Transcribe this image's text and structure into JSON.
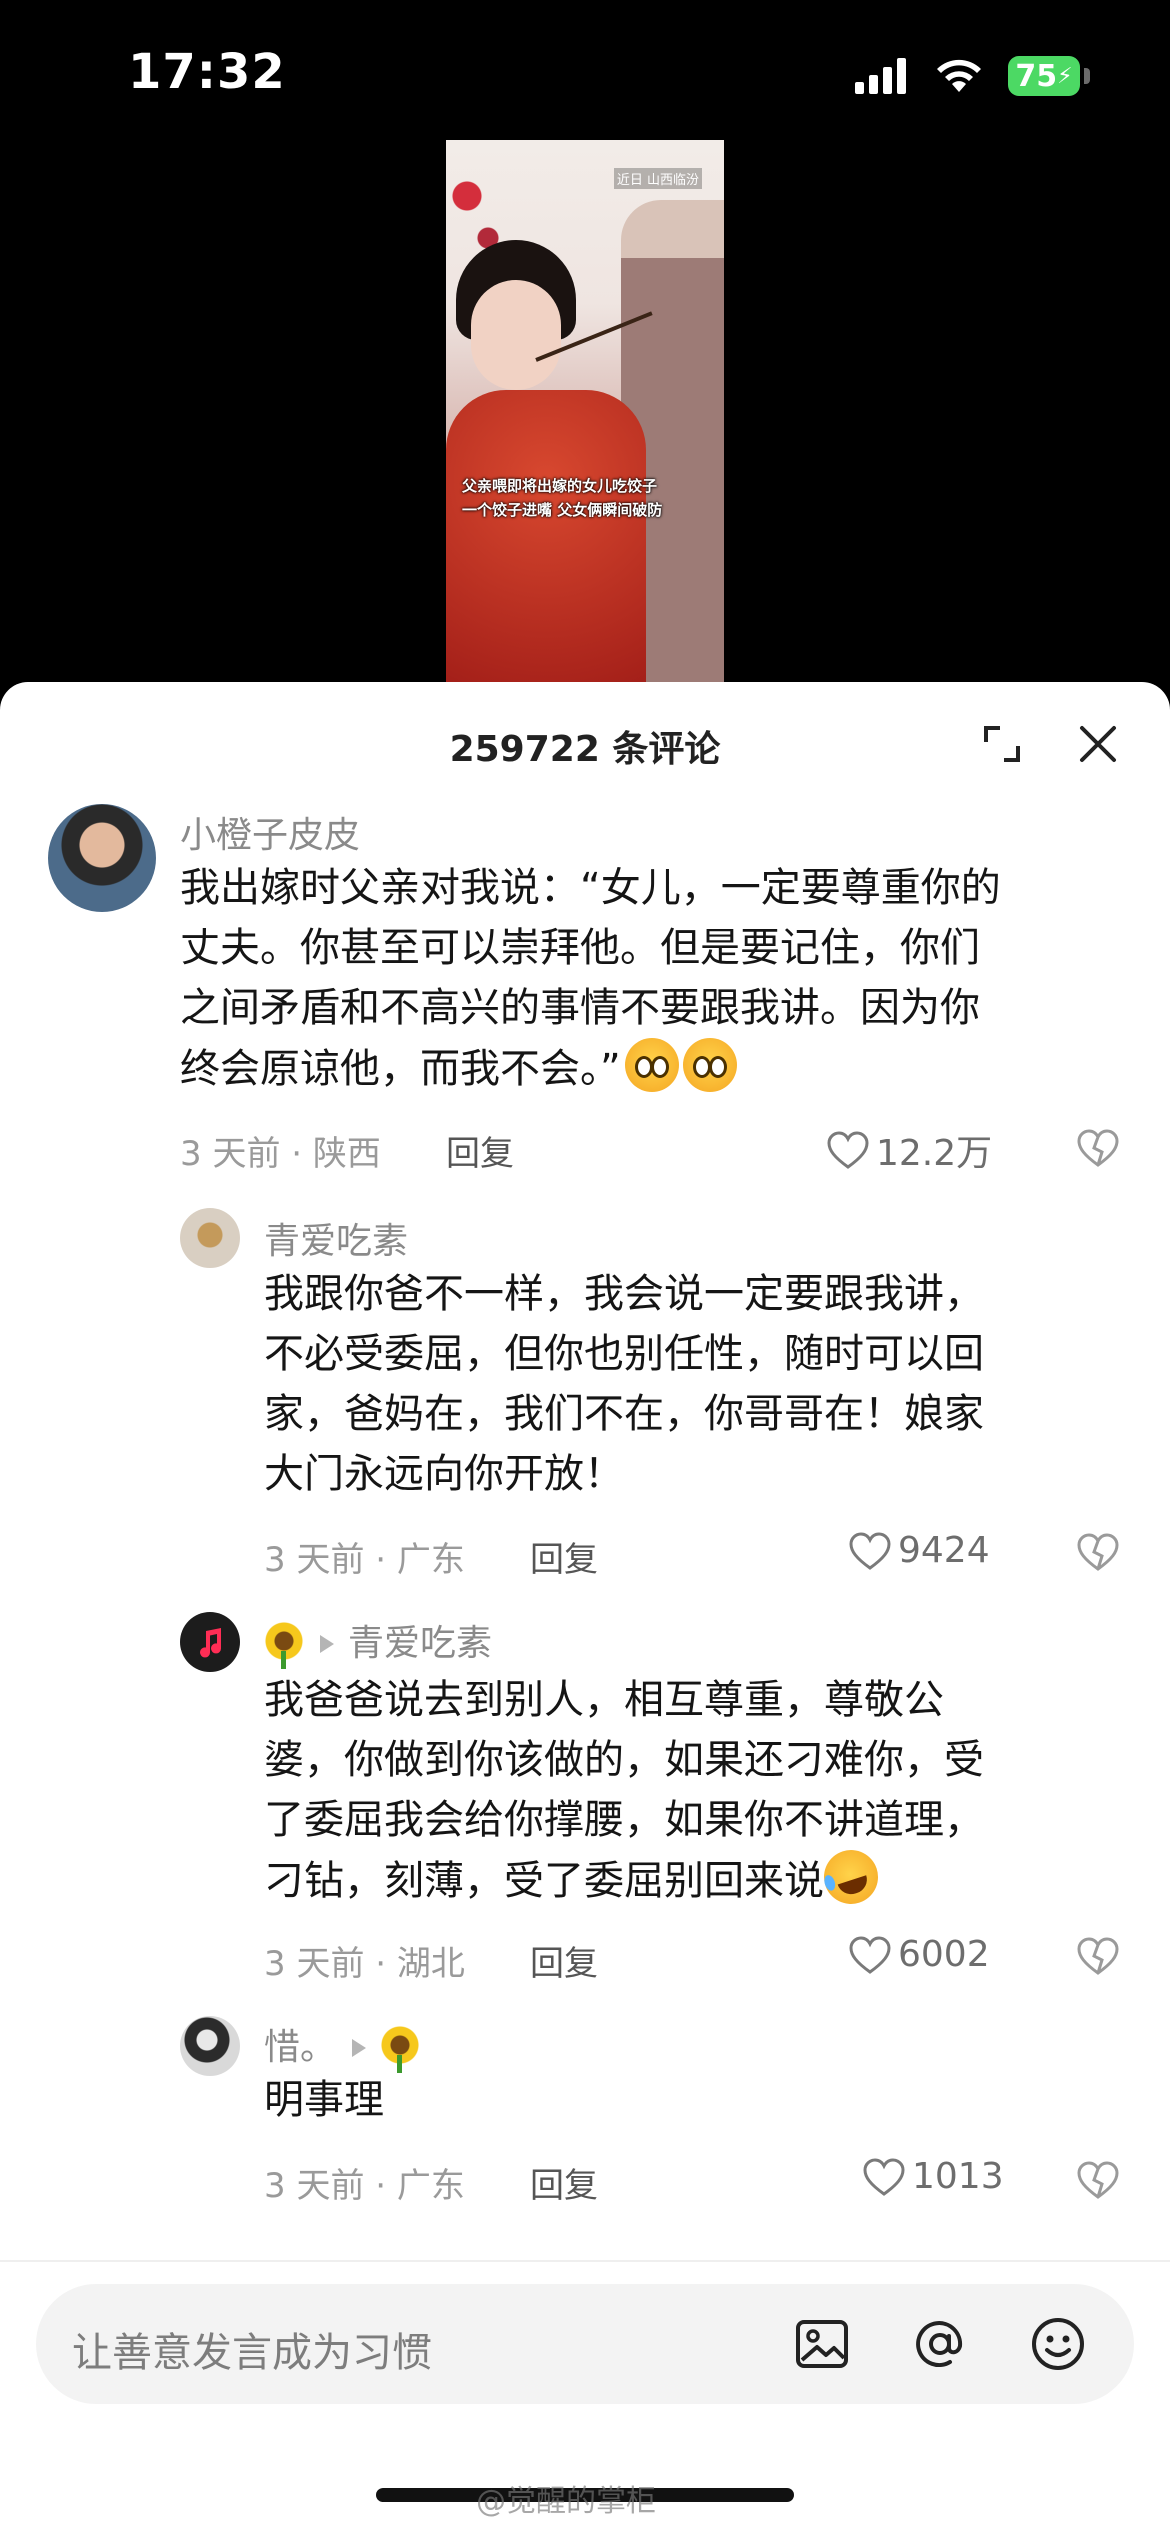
{
  "status_bar": {
    "time": "17:32",
    "battery": "75"
  },
  "video": {
    "location_tag": "近日 山西临汾",
    "caption_line1": "父亲喂即将出嫁的女儿吃饺子",
    "caption_line2": "一个饺子进嘴 父女俩瞬间破防"
  },
  "comments_header": {
    "title": "259722 条评论"
  },
  "comments": [
    {
      "username": "小橙子皮皮",
      "lines": [
        "我出嫁时父亲对我说：“女儿，一定要尊重你的",
        "丈夫。你甚至可以崇拜他。但是要记住，你们",
        "之间矛盾和不高兴的事情不要跟我讲。因为你",
        "终会原谅他，而我不会。”"
      ],
      "meta": "3 天前 · 陕西",
      "reply_label": "回复",
      "likes": "12.2万"
    },
    {
      "username": "青爱吃素",
      "lines": [
        "我跟你爸不一样，我会说一定要跟我讲，",
        "不必受委屈，但你也别任性，随时可以回",
        "家，爸妈在，我们不在，你哥哥在！娘家",
        "大门永远向你开放！"
      ],
      "meta": "3 天前 · 广东",
      "reply_label": "回复",
      "likes": "9424"
    },
    {
      "reply_to": "青爱吃素",
      "lines": [
        "我爸爸说去到别人，相互尊重，尊敬公",
        "婆，你做到你该做的，如果还刁难你，受",
        "了委屈我会给你撑腰，如果你不讲道理，",
        "刁钻，刻薄，受了委屈别回来说"
      ],
      "meta": "3 天前 · 湖北",
      "reply_label": "回复",
      "likes": "6002"
    },
    {
      "username": "惜。",
      "lines": [
        "明事理"
      ],
      "meta": "3 天前 · 广东",
      "reply_label": "回复",
      "likes": "1013"
    }
  ],
  "input_bar": {
    "placeholder": "让善意发言成为习惯"
  },
  "watermark": "@觉醒的掌柜"
}
